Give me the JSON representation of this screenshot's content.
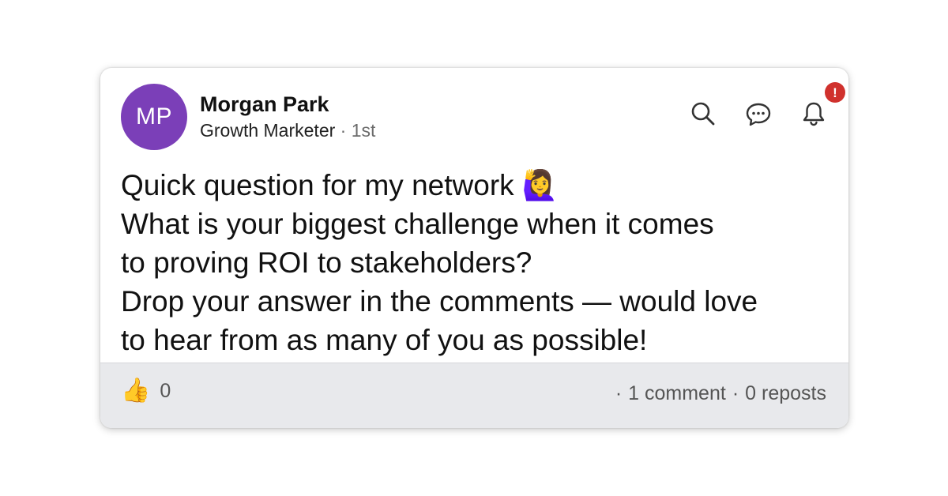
{
  "author": {
    "initials": "MP",
    "name": "Morgan Park",
    "headline": "Growth Marketer",
    "separator": "·",
    "degree": "1st",
    "avatar_color": "#7b3fb8"
  },
  "toolbar": {
    "icons": [
      "search-icon",
      "message-icon",
      "bell-icon"
    ],
    "notification_badge": "!",
    "badge_color": "#d0312d"
  },
  "post": {
    "line1": "Quick question for my network 🙋‍♀️",
    "line2": "What is your biggest challenge when it comes",
    "line3": "to proving ROI to stakeholders?",
    "line4": "Drop your answer in the comments — would love",
    "line5": "to hear from as many of you as possible!"
  },
  "footer": {
    "reaction_emoji": "👍",
    "reaction_count": "0",
    "sep1": "·",
    "comments": "1 comment",
    "sep2": "·",
    "reposts": "0 reposts"
  }
}
